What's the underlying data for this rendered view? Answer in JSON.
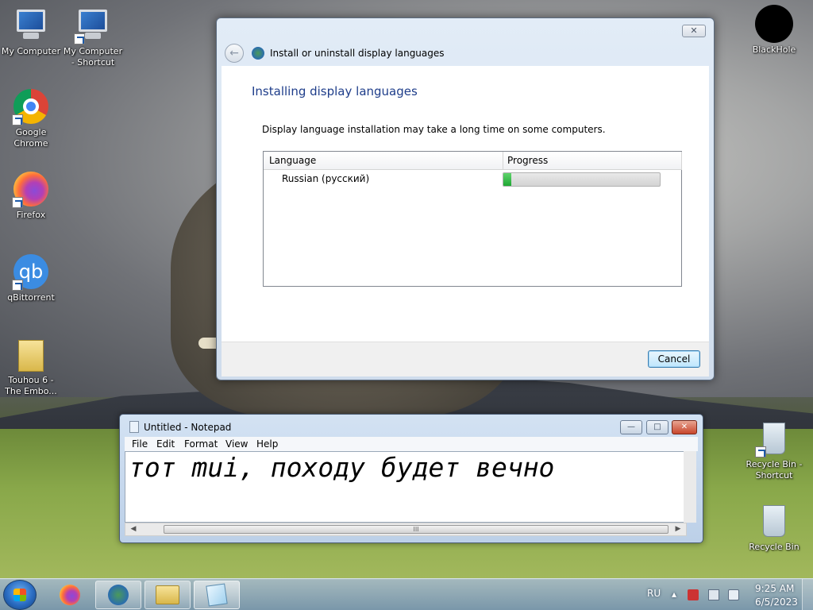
{
  "desktop": {
    "icons": [
      {
        "label": "My Computer"
      },
      {
        "label": "My Computer - Shortcut"
      },
      {
        "label": "Google Chrome"
      },
      {
        "label": "Firefox"
      },
      {
        "label": "qBittorrent"
      },
      {
        "label": "Touhou 6 - The Embo..."
      },
      {
        "label": "BlackHole"
      },
      {
        "label": "Recycle Bin - Shortcut"
      },
      {
        "label": "Recycle Bin"
      }
    ],
    "qbt_glyph": "qb"
  },
  "dialog": {
    "title": "Install or uninstall display languages",
    "heading": "Installing display languages",
    "description": "Display language installation may take a long time on some computers.",
    "table": {
      "col_language": "Language",
      "col_progress": "Progress",
      "rows": [
        {
          "language": "Russian (русский)",
          "progress": 0.05
        }
      ]
    },
    "cancel_label": "Cancel",
    "close_glyph": "✕",
    "back_glyph": "←"
  },
  "notepad": {
    "title": "Untitled - Notepad",
    "menu": [
      "File",
      "Edit",
      "Format",
      "View",
      "Help"
    ],
    "content": "тот mui, походу будет вечно",
    "scroll_thumb": "III"
  },
  "taskbar": {
    "language_indicator": "RU",
    "time": "9:25 AM",
    "date": "6/5/2023",
    "tray_up_glyph": "▴"
  },
  "colors": {
    "dialog_heading": "#1e3d8a",
    "progress_fill": "#1fa834",
    "cancel_border": "#3c7fb1"
  }
}
